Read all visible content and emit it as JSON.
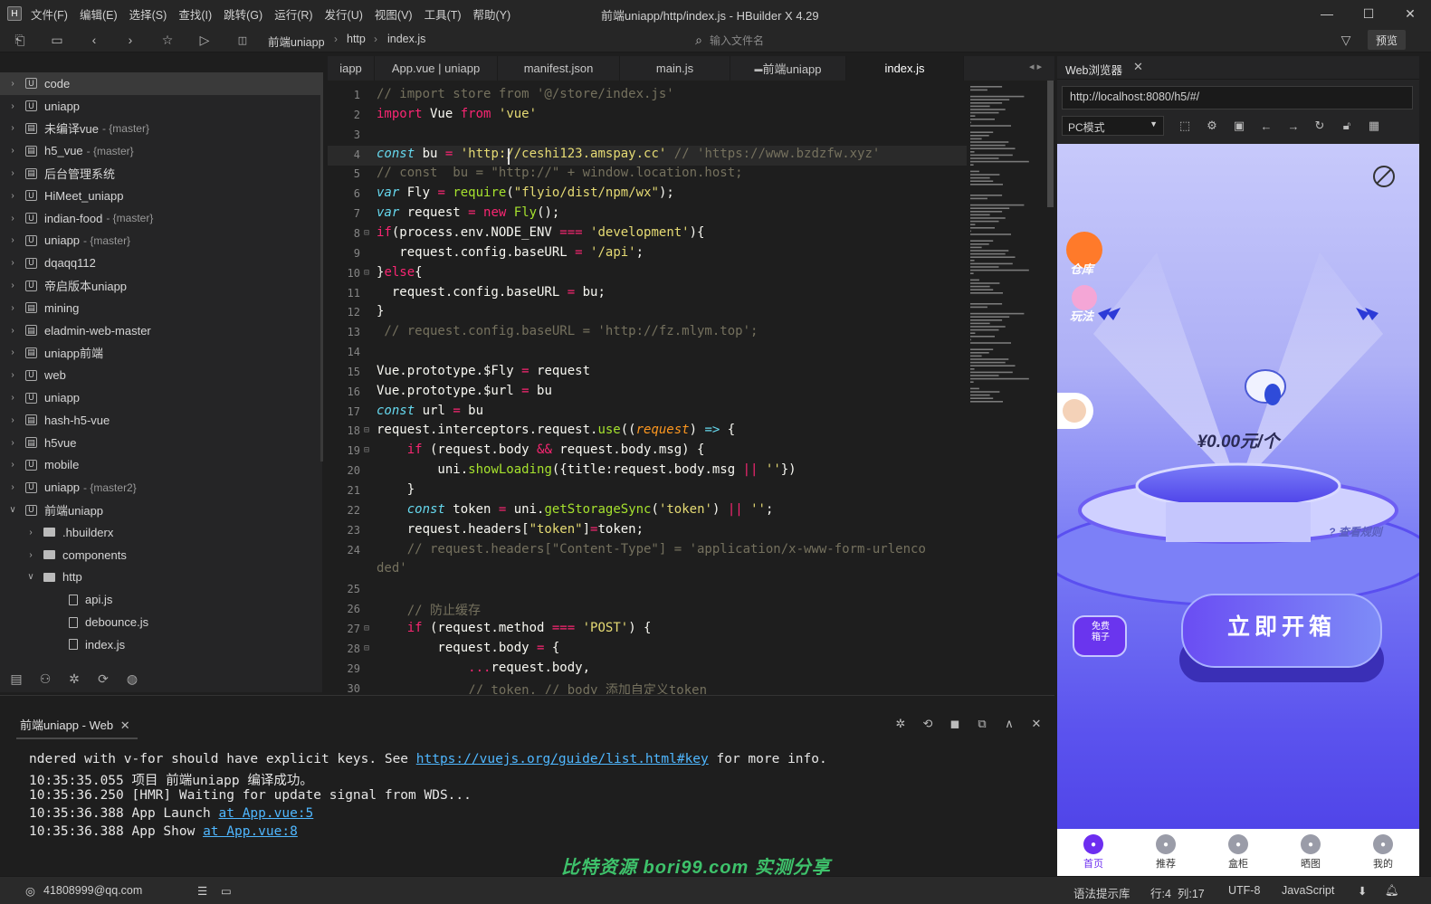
{
  "window": {
    "app_icon": "H",
    "title": "前端uniapp/http/index.js - HBuilder X 4.29",
    "menu": [
      "文件(F)",
      "编辑(E)",
      "选择(S)",
      "查找(I)",
      "跳转(G)",
      "运行(R)",
      "发行(U)",
      "视图(V)",
      "工具(T)",
      "帮助(Y)"
    ]
  },
  "toolbar": {
    "breadcrumb": [
      "前端uniapp",
      "http",
      "index.js"
    ],
    "file_search_placeholder": "输入文件名",
    "preview_label": "预览"
  },
  "sidebar": {
    "items": [
      {
        "label": "code",
        "branch": "",
        "type": "uniapp",
        "depth": 0,
        "expanded": false
      },
      {
        "label": "uniapp",
        "branch": "",
        "type": "uniapp",
        "depth": 0,
        "expanded": false
      },
      {
        "label": "未编译vue",
        "branch": "- {master}",
        "type": "project",
        "depth": 0,
        "expanded": false
      },
      {
        "label": "h5_vue",
        "branch": "- {master}",
        "type": "project",
        "depth": 0,
        "expanded": false
      },
      {
        "label": "后台管理系统",
        "branch": "",
        "type": "project",
        "depth": 0,
        "expanded": false
      },
      {
        "label": "HiMeet_uniapp",
        "branch": "",
        "type": "uniapp",
        "depth": 0,
        "expanded": false
      },
      {
        "label": "indian-food",
        "branch": "- {master}",
        "type": "uniapp",
        "depth": 0,
        "expanded": false
      },
      {
        "label": "uniapp",
        "branch": "- {master}",
        "type": "uniapp",
        "depth": 0,
        "expanded": false
      },
      {
        "label": "dqaqq112",
        "branch": "",
        "type": "uniapp",
        "depth": 0,
        "expanded": false
      },
      {
        "label": "帝启版本uniapp",
        "branch": "",
        "type": "uniapp",
        "depth": 0,
        "expanded": false
      },
      {
        "label": "mining",
        "branch": "",
        "type": "project",
        "depth": 0,
        "expanded": false
      },
      {
        "label": "eladmin-web-master",
        "branch": "",
        "type": "project",
        "depth": 0,
        "expanded": false
      },
      {
        "label": "uniapp前端",
        "branch": "",
        "type": "project",
        "depth": 0,
        "expanded": false
      },
      {
        "label": "web",
        "branch": "",
        "type": "uniapp",
        "depth": 0,
        "expanded": false
      },
      {
        "label": "uniapp",
        "branch": "",
        "type": "uniapp",
        "depth": 0,
        "expanded": false
      },
      {
        "label": "hash-h5-vue",
        "branch": "",
        "type": "project",
        "depth": 0,
        "expanded": false
      },
      {
        "label": "h5vue",
        "branch": "",
        "type": "project",
        "depth": 0,
        "expanded": false
      },
      {
        "label": "mobile",
        "branch": "",
        "type": "uniapp",
        "depth": 0,
        "expanded": false
      },
      {
        "label": "uniapp",
        "branch": "- {master2}",
        "type": "uniapp",
        "depth": 0,
        "expanded": false
      },
      {
        "label": "前端uniapp",
        "branch": "",
        "type": "uniapp",
        "depth": 0,
        "expanded": true
      },
      {
        "label": ".hbuilderx",
        "branch": "",
        "type": "folder",
        "depth": 1,
        "expanded": false
      },
      {
        "label": "components",
        "branch": "",
        "type": "folder",
        "depth": 1,
        "expanded": false
      },
      {
        "label": "http",
        "branch": "",
        "type": "folder",
        "depth": 1,
        "expanded": true
      },
      {
        "label": "api.js",
        "branch": "",
        "type": "file",
        "depth": 2,
        "expanded": null
      },
      {
        "label": "debounce.js",
        "branch": "",
        "type": "file",
        "depth": 2,
        "expanded": null
      },
      {
        "label": "index.js",
        "branch": "",
        "type": "file",
        "depth": 2,
        "expanded": null
      }
    ]
  },
  "editor": {
    "tabs": [
      "iapp",
      "App.vue | uniapp",
      "manifest.json",
      "main.js",
      "前端uniapp",
      "index.js"
    ],
    "active_tab": 5,
    "lines": [
      {
        "n": "1",
        "fold": "",
        "t": [
          [
            "cm",
            "// import store from '@/store/index.js'"
          ]
        ]
      },
      {
        "n": "2",
        "fold": "",
        "t": [
          [
            "kw",
            "import"
          ],
          [
            "df",
            " Vue "
          ],
          [
            "kw",
            "from"
          ],
          [
            "df",
            " "
          ],
          [
            "str",
            "'vue'"
          ]
        ]
      },
      {
        "n": "3",
        "fold": "",
        "t": []
      },
      {
        "n": "4",
        "fold": "",
        "cur": true,
        "t": [
          [
            "kw2",
            "const"
          ],
          [
            "df",
            " bu "
          ],
          [
            "kw",
            "="
          ],
          [
            "df",
            " "
          ],
          [
            "str",
            "'http://ceshi123.amspay.cc'"
          ],
          [
            "df",
            " "
          ],
          [
            "cm",
            "// 'https://www.bzdzfw.xyz'"
          ]
        ]
      },
      {
        "n": "5",
        "fold": "",
        "t": [
          [
            "cm",
            "// const  bu = \"http://\" + window.location.host;"
          ]
        ]
      },
      {
        "n": "6",
        "fold": "",
        "t": [
          [
            "kw2",
            "var"
          ],
          [
            "df",
            " Fly "
          ],
          [
            "kw",
            "="
          ],
          [
            "df",
            " "
          ],
          [
            "fn",
            "require"
          ],
          [
            "df",
            "("
          ],
          [
            "str",
            "\"flyio/dist/npm/wx\""
          ],
          [
            "df",
            ");"
          ]
        ]
      },
      {
        "n": "7",
        "fold": "",
        "t": [
          [
            "kw2",
            "var"
          ],
          [
            "df",
            " request "
          ],
          [
            "kw",
            "="
          ],
          [
            "df",
            " "
          ],
          [
            "kw",
            "new"
          ],
          [
            "df",
            " "
          ],
          [
            "fn",
            "Fly"
          ],
          [
            "df",
            "();"
          ]
        ]
      },
      {
        "n": "8",
        "fold": "⊟",
        "t": [
          [
            "kw",
            "if"
          ],
          [
            "df",
            "(process.env.NODE_ENV "
          ],
          [
            "kw",
            "==="
          ],
          [
            "df",
            " "
          ],
          [
            "str",
            "'development'"
          ],
          [
            "df",
            "){"
          ]
        ]
      },
      {
        "n": "9",
        "fold": "",
        "t": [
          [
            "df",
            "   request.config.baseURL "
          ],
          [
            "kw",
            "="
          ],
          [
            "df",
            " "
          ],
          [
            "str",
            "'/api'"
          ],
          [
            "df",
            ";"
          ]
        ]
      },
      {
        "n": "10",
        "fold": "⊟",
        "t": [
          [
            "df",
            "}"
          ],
          [
            "kw",
            "else"
          ],
          [
            "df",
            "{"
          ]
        ]
      },
      {
        "n": "11",
        "fold": "",
        "t": [
          [
            "df",
            "  request.config.baseURL "
          ],
          [
            "kw",
            "="
          ],
          [
            "df",
            " bu;"
          ]
        ]
      },
      {
        "n": "12",
        "fold": "",
        "t": [
          [
            "df",
            "}"
          ]
        ]
      },
      {
        "n": "13",
        "fold": "",
        "t": [
          [
            "cm",
            " // request.config.baseURL = 'http://fz.mlym.top';"
          ]
        ]
      },
      {
        "n": "14",
        "fold": "",
        "t": []
      },
      {
        "n": "15",
        "fold": "",
        "t": [
          [
            "df",
            "Vue.prototype.$Fly "
          ],
          [
            "kw",
            "="
          ],
          [
            "df",
            " request"
          ]
        ]
      },
      {
        "n": "16",
        "fold": "",
        "t": [
          [
            "df",
            "Vue.prototype.$url "
          ],
          [
            "kw",
            "="
          ],
          [
            "df",
            " bu"
          ]
        ]
      },
      {
        "n": "17",
        "fold": "",
        "t": [
          [
            "kw2",
            "const"
          ],
          [
            "df",
            " url "
          ],
          [
            "kw",
            "="
          ],
          [
            "df",
            " bu"
          ]
        ]
      },
      {
        "n": "18",
        "fold": "⊟",
        "t": [
          [
            "df",
            "request.interceptors.request."
          ],
          [
            "fn",
            "use"
          ],
          [
            "df",
            "(("
          ],
          [
            "pm",
            "request"
          ],
          [
            "df",
            ") "
          ],
          [
            "kw2",
            "=>"
          ],
          [
            "df",
            " {"
          ]
        ]
      },
      {
        "n": "19",
        "fold": "⊟",
        "t": [
          [
            "df",
            "    "
          ],
          [
            "kw",
            "if"
          ],
          [
            "df",
            " (request.body "
          ],
          [
            "kw",
            "&&"
          ],
          [
            "df",
            " request.body.msg) {"
          ]
        ]
      },
      {
        "n": "20",
        "fold": "",
        "t": [
          [
            "df",
            "        uni."
          ],
          [
            "fn",
            "showLoading"
          ],
          [
            "df",
            "({title:request.body.msg "
          ],
          [
            "kw",
            "||"
          ],
          [
            "df",
            " "
          ],
          [
            "str",
            "''"
          ],
          [
            "df",
            "})"
          ]
        ]
      },
      {
        "n": "21",
        "fold": "",
        "t": [
          [
            "df",
            "    }"
          ]
        ]
      },
      {
        "n": "22",
        "fold": "",
        "t": [
          [
            "df",
            "    "
          ],
          [
            "kw2",
            "const"
          ],
          [
            "df",
            " token "
          ],
          [
            "kw",
            "="
          ],
          [
            "df",
            " uni."
          ],
          [
            "fn",
            "getStorageSync"
          ],
          [
            "df",
            "("
          ],
          [
            "str",
            "'token'"
          ],
          [
            "df",
            ") "
          ],
          [
            "kw",
            "||"
          ],
          [
            "df",
            " "
          ],
          [
            "str",
            "''"
          ],
          [
            "df",
            ";"
          ]
        ]
      },
      {
        "n": "23",
        "fold": "",
        "t": [
          [
            "df",
            "    request.headers["
          ],
          [
            "str",
            "\"token\""
          ],
          [
            "df",
            "]"
          ],
          [
            "kw",
            "="
          ],
          [
            "df",
            "token;"
          ]
        ]
      },
      {
        "n": "24",
        "fold": "",
        "t": [
          [
            "cm",
            "    // request.headers[\"Content-Type\"] = 'application/x-www-form-urlenco"
          ]
        ]
      },
      {
        "n": "",
        "fold": "",
        "t": [
          [
            "cm",
            "ded'"
          ]
        ]
      },
      {
        "n": "25",
        "fold": "",
        "t": []
      },
      {
        "n": "26",
        "fold": "",
        "t": [
          [
            "cm",
            "    // 防止缓存"
          ]
        ]
      },
      {
        "n": "27",
        "fold": "⊟",
        "t": [
          [
            "df",
            "    "
          ],
          [
            "kw",
            "if"
          ],
          [
            "df",
            " (request.method "
          ],
          [
            "kw",
            "==="
          ],
          [
            "df",
            " "
          ],
          [
            "str",
            "'POST'"
          ],
          [
            "df",
            ") {"
          ]
        ]
      },
      {
        "n": "28",
        "fold": "⊟",
        "t": [
          [
            "df",
            "        request.body "
          ],
          [
            "kw",
            "="
          ],
          [
            "df",
            " {"
          ]
        ]
      },
      {
        "n": "29",
        "fold": "",
        "t": [
          [
            "df",
            "            "
          ],
          [
            "kw",
            "..."
          ],
          [
            "df",
            "request.body,"
          ]
        ]
      },
      {
        "n": "30",
        "fold": "",
        "t": [
          [
            "cm",
            "            // token, // body 添加自定义token"
          ]
        ]
      }
    ]
  },
  "browser": {
    "tab_label": "Web浏览器",
    "url": "http://localhost:8080/h5/#/",
    "mode": "PC模式",
    "app": {
      "side_warehouse": "仓库",
      "side_play": "玩法",
      "price": "¥0.00元/个",
      "rules": "查看规则",
      "free_box_line1": "免费",
      "free_box_line2": "箱子",
      "open_button": "立即开箱",
      "nav": [
        {
          "label": "首页",
          "icon": "home-icon",
          "active": true
        },
        {
          "label": "推荐",
          "icon": "thumb-icon",
          "active": false
        },
        {
          "label": "盒柜",
          "icon": "box-icon",
          "active": false
        },
        {
          "label": "晒图",
          "icon": "camera-icon",
          "active": false
        },
        {
          "label": "我的",
          "icon": "user-icon",
          "active": false
        }
      ]
    }
  },
  "console": {
    "tab_label": "前端uniapp - Web",
    "lines": [
      {
        "pre": "ndered with v-for should have explicit keys. See ",
        "link": "https://vuejs.org/guide/list.html#key",
        "post": " for more info."
      },
      {
        "pre": "10:35:35.055 项目 前端uniapp 编译成功。",
        "link": "",
        "post": ""
      },
      {
        "pre": "10:35:36.250 [HMR] Waiting for update signal from WDS...",
        "link": "",
        "post": ""
      },
      {
        "pre": "10:35:36.388 App Launch ",
        "link": "at App.vue:5",
        "post": ""
      },
      {
        "pre": "10:35:36.388 App Show ",
        "link": "at App.vue:8",
        "post": ""
      }
    ],
    "watermark": "比特资源 bori99.com 实测分享"
  },
  "statusbar": {
    "user": "41808999@qq.com",
    "hint_lib": "语法提示库",
    "position": "行:4  列:17",
    "encoding": "UTF-8",
    "language": "JavaScript"
  }
}
